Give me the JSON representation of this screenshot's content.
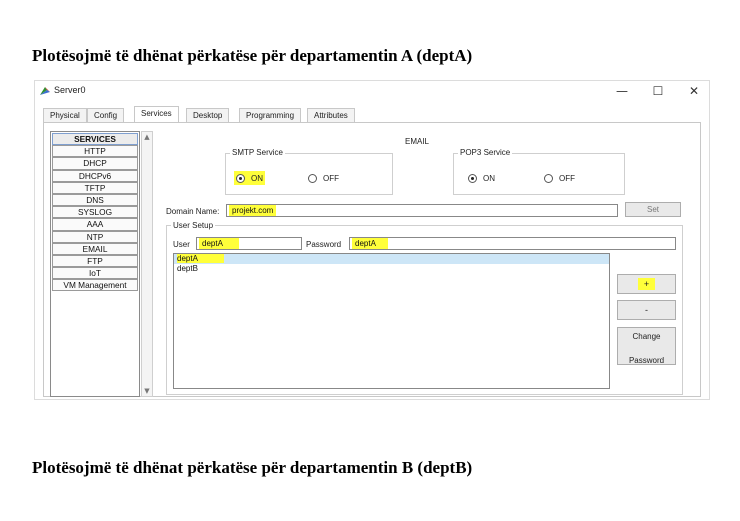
{
  "headings": {
    "dept_a": "Plotësojmë të dhënat përkatëse për departamentin A (deptA)",
    "dept_b": "Plotësojmë të dhënat përkatëse për departamentin B (deptB)"
  },
  "window": {
    "title": "Server0",
    "controls": {
      "minimize": "—",
      "maximize": "☐",
      "close": "✕"
    }
  },
  "tabs": [
    "Physical",
    "Config",
    "Services",
    "Desktop",
    "Programming",
    "Attributes"
  ],
  "active_tab": "Services",
  "services": {
    "header": "SERVICES",
    "items": [
      "HTTP",
      "DHCP",
      "DHCPv6",
      "TFTP",
      "DNS",
      "SYSLOG",
      "AAA",
      "NTP",
      "EMAIL",
      "FTP",
      "IoT",
      "VM Management"
    ]
  },
  "email": {
    "title": "EMAIL",
    "smtp": {
      "legend": "SMTP Service",
      "on": "ON",
      "off": "OFF",
      "selected": "ON"
    },
    "pop3": {
      "legend": "POP3 Service",
      "on": "ON",
      "off": "OFF",
      "selected": "ON"
    },
    "domain": {
      "label": "Domain Name:",
      "value": "projekt.com",
      "set_button": "Set"
    },
    "user_setup": {
      "legend": "User Setup",
      "user_label": "User",
      "user_value": "deptA",
      "password_label": "Password",
      "password_value": "deptA",
      "users": [
        "deptA",
        "deptB"
      ],
      "selected_user": "deptA",
      "add_button": "+",
      "remove_button": "-",
      "change_password_line1": "Change",
      "change_password_line2": "Password"
    }
  },
  "colors": {
    "highlight": "#ffff3a",
    "selection": "#cde6f7"
  }
}
